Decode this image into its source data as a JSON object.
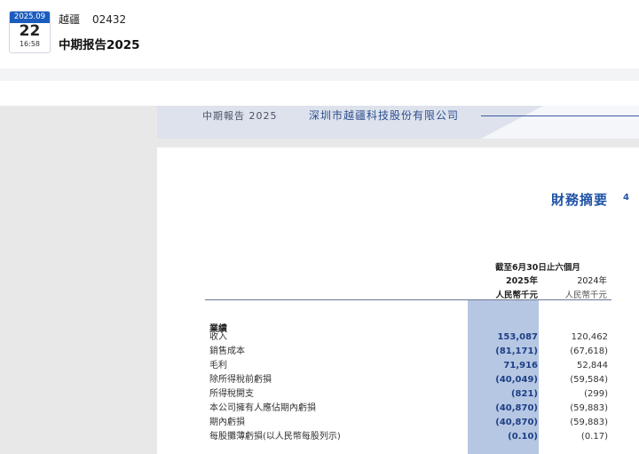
{
  "badge": {
    "year_month": "2025.09",
    "day": "22",
    "time": "16:58"
  },
  "stock": {
    "name": "越疆",
    "code": "02432"
  },
  "document_title": "中期报告2025",
  "page_header": {
    "left": "中期報告 2025",
    "company": "深圳市越疆科技股份有限公司"
  },
  "section": {
    "title": "財務摘要",
    "page_number": "4"
  },
  "columns": {
    "period": "截至6月30日止六個月",
    "year_current": "2025年",
    "year_prior": "2024年",
    "unit_current": "人民幣千元",
    "unit_prior": "人民幣千元"
  },
  "table": {
    "section_label": "業績",
    "rows": [
      {
        "label": "收入",
        "v2025": "153,087",
        "v2024": "120,462"
      },
      {
        "label": "銷售成本",
        "v2025": "(81,171)",
        "v2024": "(67,618)"
      },
      {
        "label": "毛利",
        "v2025": "71,916",
        "v2024": "52,844"
      },
      {
        "label": "除所得稅前虧損",
        "v2025": "(40,049)",
        "v2024": "(59,584)"
      },
      {
        "label": "所得稅開支",
        "v2025": "(821)",
        "v2024": "(299)"
      },
      {
        "label": "本公司擁有人應佔期內虧損",
        "v2025": "(40,870)",
        "v2024": "(59,883)"
      },
      {
        "label": "期內虧損",
        "v2025": "(40,870)",
        "v2024": "(59,883)"
      },
      {
        "label": "每股攤薄虧損(以人民幣每股列示)",
        "v2025": "(0.10)",
        "v2024": "(0.17)"
      }
    ]
  },
  "colors": {
    "brand_blue": "#1b5dbe",
    "section_blue": "#2052a6",
    "highlight": "#b6c7e3"
  }
}
